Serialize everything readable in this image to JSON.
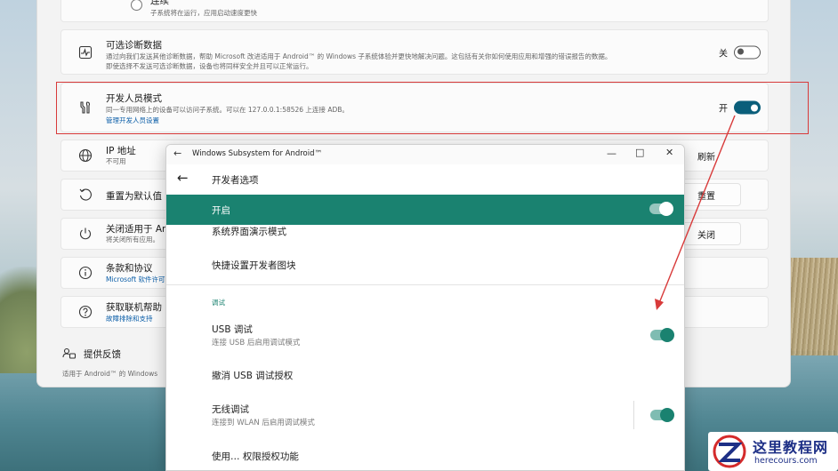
{
  "settings": {
    "continuous": {
      "label": "连续",
      "desc": "子系统将在运行，应用启动速度更快"
    },
    "diagnostics": {
      "title": "可选诊断数据",
      "desc1": "通过向我们发送其他诊断数据，帮助 Microsoft 改进适用于 Android™ 的 Windows 子系统体验并更快地解决问题。这包括有关你如何使用应用和增强的错误报告的数据。",
      "desc2": "即使选择不发送可选诊断数据，设备也将同样安全并且可以正常运行。",
      "toggle_label": "关"
    },
    "developer": {
      "title": "开发人员模式",
      "desc": "同一专用网络上的设备可以访问子系统。可以在 127.0.0.1:58526 上连接 ADB。",
      "link": "管理开发人员设置",
      "toggle_label": "开"
    },
    "ip": {
      "title": "IP 地址",
      "desc": "不可用",
      "action": "刷新"
    },
    "reset": {
      "title": "重置为默认值",
      "action": "重置"
    },
    "shutdown": {
      "title": "关闭适用于 Andr",
      "desc": "将关闭所有应用。",
      "action": "关闭"
    },
    "terms": {
      "title": "条款和协议",
      "desc": "Microsoft 软件许可"
    },
    "help": {
      "title": "获取联机帮助",
      "desc": "故障排除和支持"
    },
    "feedback": "提供反馈",
    "footnote": "适用于 Android™ 的 Windows"
  },
  "wsa": {
    "window_title": "Windows Subsystem for Android™",
    "page_title": "开发者选项",
    "master_switch_label": "开启",
    "items": {
      "demo_mode": "系统界面演示模式",
      "quick_tiles": "快捷设置开发者图块",
      "category_debug": "调试",
      "usb_debug": "USB 调试",
      "usb_debug_desc": "连接 USB 后启用调试模式",
      "revoke_usb": "撤消 USB 调试授权",
      "wireless_debug": "无线调试",
      "wireless_debug_desc": "连接到 WLAN 后启用调试模式",
      "partial_next": "使用… 权限授权功能"
    }
  },
  "watermark": {
    "title": "这里教程网",
    "url": "herecours.com"
  },
  "colors": {
    "accent_teal": "#1a8270",
    "toggle_blue": "#0a5e7a",
    "highlight_red": "#d83a3a"
  }
}
